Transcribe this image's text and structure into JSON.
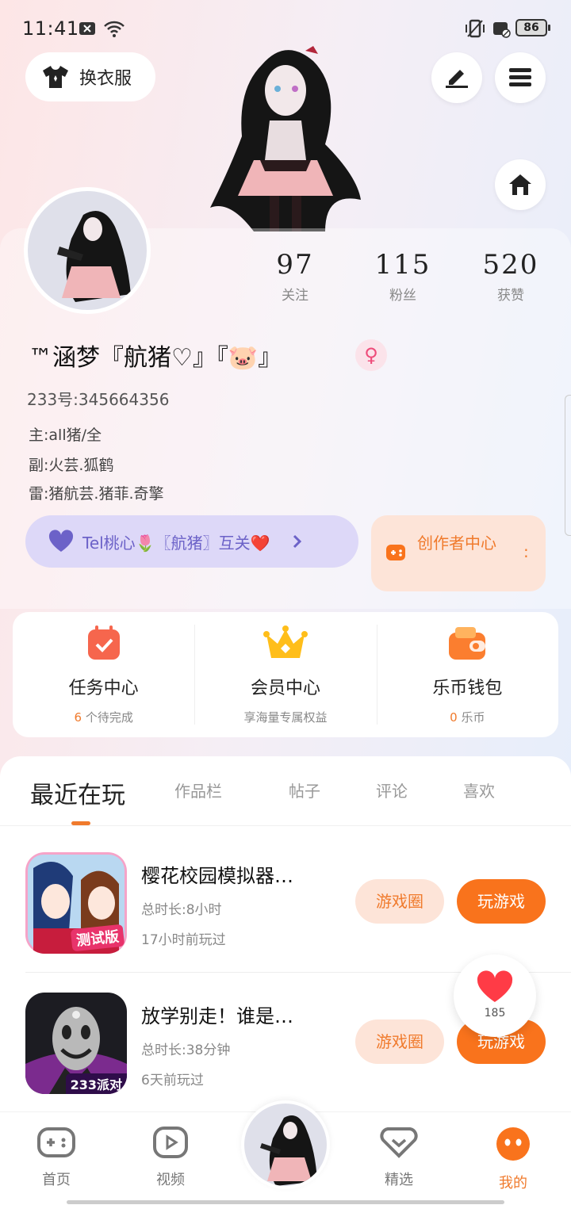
{
  "status_bar": {
    "time": "11:41",
    "battery": "86"
  },
  "header": {
    "dress_label": "换衣服"
  },
  "profile": {
    "stats": [
      {
        "num": "97",
        "label": "关注"
      },
      {
        "num": "115",
        "label": "粉丝"
      },
      {
        "num": "520",
        "label": "获赞"
      }
    ],
    "nickname": "™涵梦『航猪♡』『🐷』",
    "gender_symbol": "♀",
    "uid": "233号:345664356",
    "bio": [
      "主:all猪/全",
      "副:火芸.狐鹤",
      "雷:猪航芸.猪菲.奇擎"
    ]
  },
  "honey": {
    "text": "Tel桃心🌷〖航猪〗互关❤️"
  },
  "creator": {
    "label": "创作者中心"
  },
  "quick": [
    {
      "title": "任务中心",
      "count": "6",
      "sub": "个待完成"
    },
    {
      "title": "会员中心",
      "count": "",
      "sub": "享海量专属权益"
    },
    {
      "title": "乐币钱包",
      "count": "0",
      "sub": "乐币"
    }
  ],
  "tabs": [
    "最近在玩",
    "作品栏",
    "帖子",
    "评论",
    "喜欢"
  ],
  "games": [
    {
      "title": "樱花校园模拟器…",
      "total_time": "总时长:8小时",
      "last_played": "17小时前玩过",
      "badge": "测试版",
      "circle_label": "游戏圈",
      "play_label": "玩游戏"
    },
    {
      "title": "放学别走！谁是…",
      "total_time": "总时长:38分钟",
      "last_played": "6天前玩过",
      "badge": "233派对",
      "circle_label": "游戏圈",
      "play_label": "玩游戏"
    }
  ],
  "like_bubble": {
    "count": "185"
  },
  "nav": [
    {
      "label": "首页",
      "icon": "gamepad-icon"
    },
    {
      "label": "视频",
      "icon": "play-icon"
    },
    {
      "label": "精选",
      "icon": "heart-icon"
    },
    {
      "label": "我的",
      "icon": "face-icon"
    }
  ],
  "colors": {
    "accent": "#f9731c",
    "purple": "#6c62c8"
  }
}
